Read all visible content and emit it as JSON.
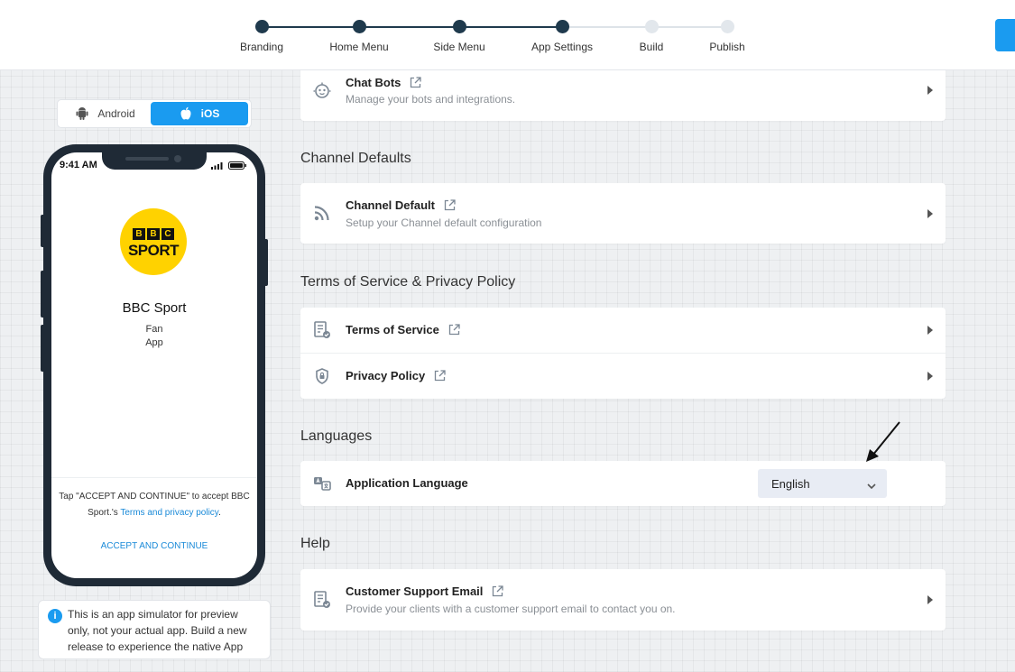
{
  "stepper": {
    "steps": [
      {
        "label": "Branding",
        "done": true
      },
      {
        "label": "Home Menu",
        "done": true
      },
      {
        "label": "Side Menu",
        "done": true
      },
      {
        "label": "App Settings",
        "done": true
      },
      {
        "label": "Build",
        "done": false
      },
      {
        "label": "Publish",
        "done": false
      }
    ]
  },
  "platform": {
    "android_label": "Android",
    "ios_label": "iOS",
    "selected": "iOS"
  },
  "phone": {
    "time": "9:41 AM",
    "logo_bbc": [
      "B",
      "B",
      "C"
    ],
    "logo_sport": "SPORT",
    "app_name": "BBC Sport",
    "app_sub_line1": "Fan",
    "app_sub_line2": "App",
    "terms_prefix": "Tap \"ACCEPT AND CONTINUE\" to accept BBC Sport.'s ",
    "terms_link": "Terms and privacy policy",
    "terms_suffix": ".",
    "accept_label": "ACCEPT AND CONTINUE"
  },
  "info_box": {
    "text": "This is an app simulator for preview only, not your actual app. Build a new release to experience the native App"
  },
  "sections": {
    "chat_bots": {
      "title": "Chat Bots",
      "desc": "Manage your bots and integrations."
    },
    "channel_defaults": {
      "heading": "Channel Defaults",
      "title": "Channel Default",
      "desc": "Setup your Channel default configuration"
    },
    "terms_privacy": {
      "heading": "Terms of Service & Privacy Policy",
      "terms_title": "Terms of Service",
      "privacy_title": "Privacy Policy"
    },
    "languages": {
      "heading": "Languages",
      "title": "Application Language",
      "selected": "English"
    },
    "help": {
      "heading": "Help",
      "title": "Customer Support Email",
      "desc": "Provide your clients with a customer support email to contact you on."
    }
  },
  "colors": {
    "accent": "#1a9bf0",
    "step_done": "#1f3a4d",
    "step_todo": "#e2e7ec",
    "logo_yellow": "#ffd200"
  }
}
